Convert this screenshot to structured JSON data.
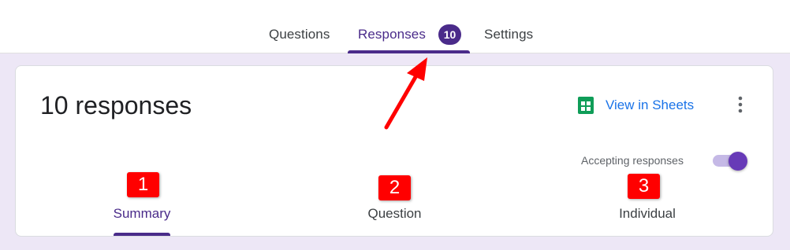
{
  "top_tabs": {
    "questions": "Questions",
    "responses": "Responses",
    "responses_badge": "10",
    "settings": "Settings",
    "active": "Responses"
  },
  "card": {
    "title": "10 responses",
    "view_in_sheets": "View in Sheets",
    "accepting_label": "Accepting responses",
    "accepting_on": true
  },
  "sub_tabs": {
    "summary": "Summary",
    "question": "Question",
    "individual": "Individual",
    "active": "Summary"
  },
  "annotations": {
    "badge_1": "1",
    "badge_2": "2",
    "badge_3": "3",
    "arrow_color": "#ff0000"
  },
  "colors": {
    "accent": "#4a2b8a",
    "toggle": "#673ab7",
    "link": "#1a73e8",
    "sheets_green": "#0f9d58",
    "page_background": "#ede7f6"
  },
  "icons": {
    "sheets": "google-sheets-icon",
    "more": "more-vert-icon"
  }
}
